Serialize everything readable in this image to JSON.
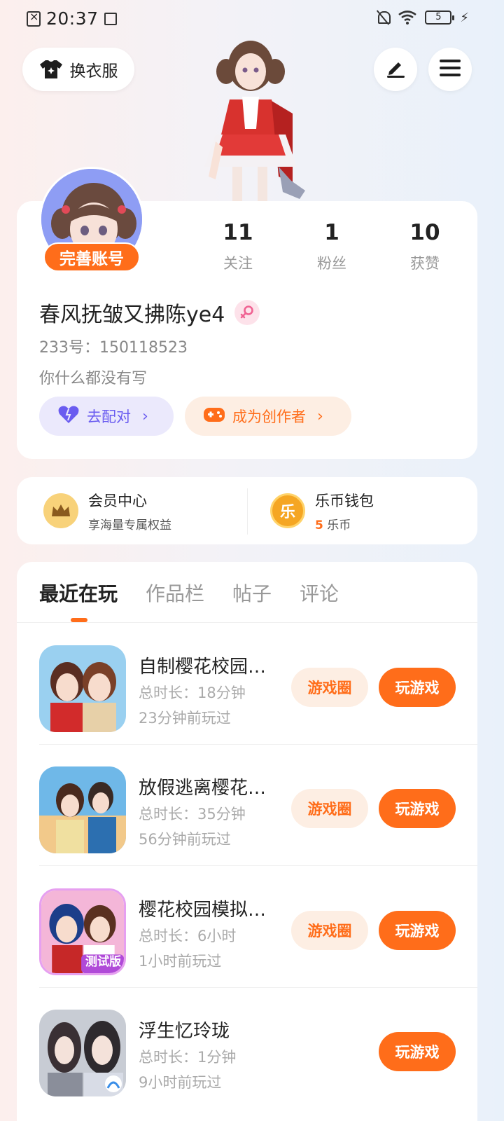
{
  "status_bar": {
    "time": "20:37",
    "battery": "5"
  },
  "top_actions": {
    "change_outfit_label": "换衣服",
    "edit_icon": "pencil-icon",
    "menu_icon": "hamburger-icon"
  },
  "profile": {
    "complete_account_label": "完善账号",
    "stats": [
      {
        "value": "11",
        "label": "关注"
      },
      {
        "value": "1",
        "label": "粉丝"
      },
      {
        "value": "10",
        "label": "获赞"
      }
    ],
    "username": "春风抚皱又拂陈ye4",
    "gender_icon": "female-icon",
    "uid": "233号：150118523",
    "bio": "你什么都没有写",
    "pair_button_label": "去配对",
    "creator_button_label": "成为创作者"
  },
  "member_center": {
    "title": "会员中心",
    "subtitle": "享海量专属权益"
  },
  "wallet": {
    "title": "乐币钱包",
    "amount": "5",
    "unit": "乐币",
    "icon_text": "乐"
  },
  "tabs": [
    "最近在玩",
    "作品栏",
    "帖子",
    "评论"
  ],
  "games": [
    {
      "name": "自制樱花校园…",
      "duration": "总时长：18分钟",
      "last_played": "23分钟前玩过",
      "circle_label": "游戏圈",
      "play_label": "玩游戏"
    },
    {
      "name": "放假逃离樱花…",
      "duration": "总时长：35分钟",
      "last_played": "56分钟前玩过",
      "circle_label": "游戏圈",
      "play_label": "玩游戏"
    },
    {
      "name": "樱花校园模拟…",
      "duration": "总时长：6小时",
      "last_played": "1小时前玩过",
      "circle_label": "游戏圈",
      "play_label": "玩游戏",
      "icon_badge": "测试版"
    },
    {
      "name": "浮生忆玲珑",
      "duration": "总时长：1分钟",
      "last_played": "9小时前玩过",
      "play_label": "玩游戏"
    }
  ],
  "colors": {
    "accent": "#ff6d1a",
    "pair": "#6a5cf0"
  }
}
